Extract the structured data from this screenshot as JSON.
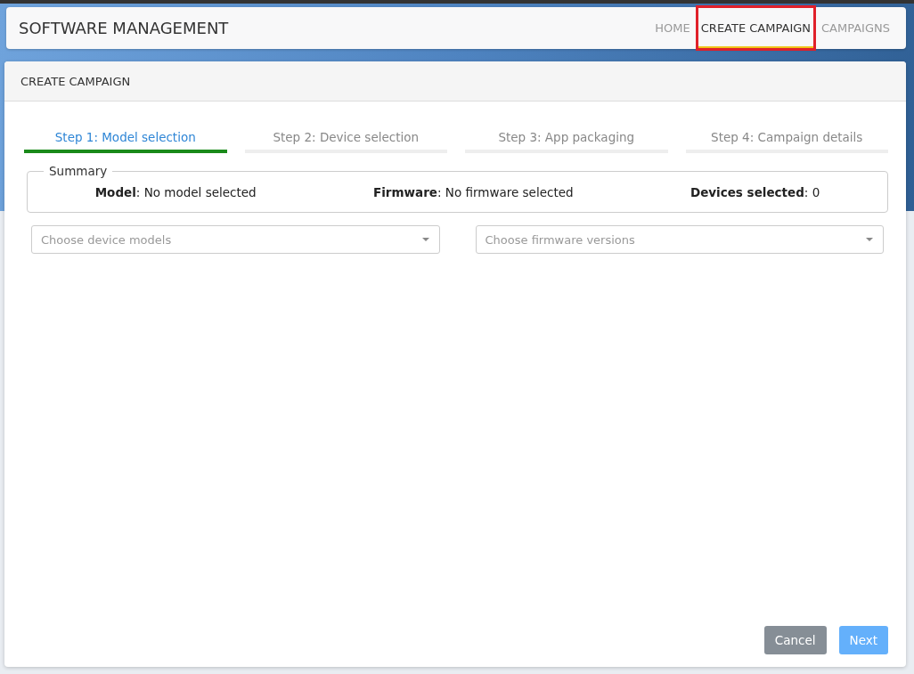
{
  "app_title": "SOFTWARE MANAGEMENT",
  "nav": [
    {
      "label": "HOME",
      "selected": false,
      "highlighted": false
    },
    {
      "label": "CREATE CAMPAIGN",
      "selected": true,
      "highlighted": true
    },
    {
      "label": "CAMPAIGNS",
      "selected": false,
      "highlighted": false
    }
  ],
  "card_title": "CREATE CAMPAIGN",
  "steps": [
    {
      "label": "Step 1: Model selection",
      "selected": true
    },
    {
      "label": "Step 2: Device selection",
      "selected": false
    },
    {
      "label": "Step 3: App packaging",
      "selected": false
    },
    {
      "label": "Step 4: Campaign details",
      "selected": false
    }
  ],
  "summary": {
    "legend": "Summary",
    "items": [
      "**Model**: No model selected",
      "**Firmware**: No firmware selected",
      "**Devices selected**: 0"
    ]
  },
  "selects": [
    {
      "placeholder": "Choose device models"
    },
    {
      "placeholder": "Choose firmware versions"
    }
  ],
  "buttons": [
    {
      "label": "Cancel",
      "kind": "secondary",
      "disabled": false
    },
    {
      "label": "Next",
      "kind": "primary",
      "disabled": true
    }
  ]
}
